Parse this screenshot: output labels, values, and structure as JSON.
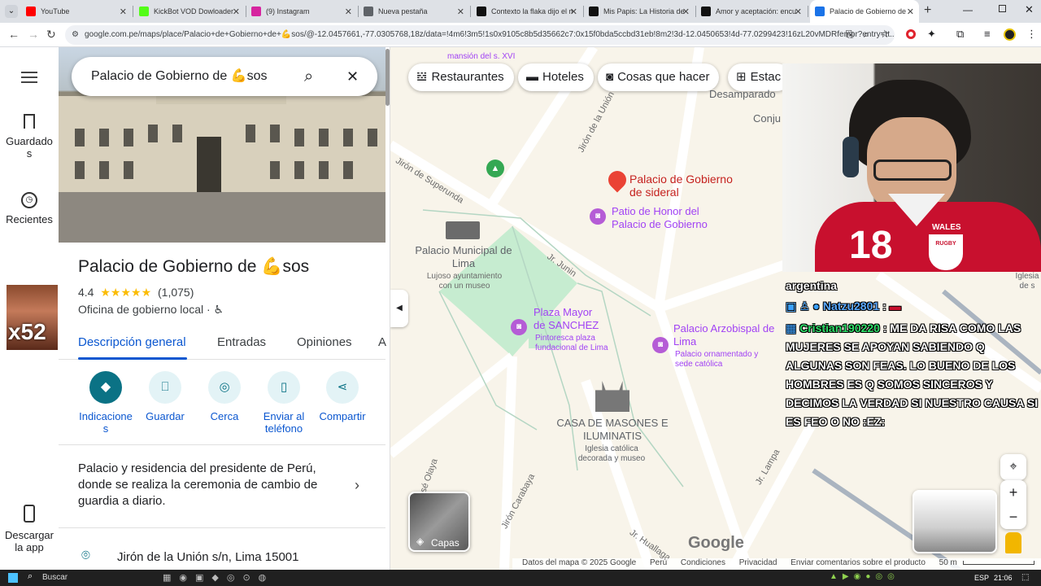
{
  "browser": {
    "tabs": [
      {
        "title": "YouTube",
        "color": "#ff0000"
      },
      {
        "title": "KickBot VOD Dowloader",
        "color": "#53fc18"
      },
      {
        "title": "(9) Instagram",
        "color": "#d6249f"
      },
      {
        "title": "Nueva pestaña",
        "color": "#5f6368"
      },
      {
        "title": "Contexto la flaka dijo el m",
        "color": "#111111"
      },
      {
        "title": "Mis Papis: La Historia de",
        "color": "#111111"
      },
      {
        "title": "Amor y aceptación: encu",
        "color": "#111111"
      },
      {
        "title": "Palacio de Gobierno de 💪sos",
        "color": "#1a73e8"
      }
    ],
    "url": "google.com.pe/maps/place/Palacio+de+Gobierno+de+💪sos/@-12.0457661,-77.0305768,18z/data=!4m6!3m5!1s0x9105c8b5d35662c7:0x15f0bda5ccbd31eb!8m2!3d-12.0450653!4d-77.0299423!16zL20vMDRfempr?entry=tt..."
  },
  "rail": {
    "saved": "Guardados",
    "recent": "Recientes",
    "thumb_badge": "x52",
    "download": "Descargar la app"
  },
  "place": {
    "search_value": "Palacio de Gobierno de 💪sos",
    "title": "Palacio de Gobierno de 💪sos",
    "rating": "4.4",
    "stars": "★★★★★",
    "reviews": "(1,075)",
    "category": "Oficina de gobierno local · ♿",
    "tabs": [
      "Descripción general",
      "Entradas",
      "Opiniones",
      "A"
    ],
    "actions": [
      "Indicaciones",
      "Guardar",
      "Cerca",
      "Enviar al teléfono",
      "Compartir"
    ],
    "description": "Palacio y residencia del presidente de Perú, donde se realiza la ceremonia de cambio de guardia a diario.",
    "address": "Jirón de la Unión s/n, Lima 15001"
  },
  "map": {
    "chips": [
      "Restaurantes",
      "Hoteles",
      "Cosas que hacer",
      "Estac"
    ],
    "pin_label": "Palacio de Gobierno de sideral",
    "labels": {
      "patio": "Patio de Honor del Palacio de Gobierno",
      "municipal": "Palacio Municipal de Lima",
      "municipal_sub": "Lujoso ayuntamiento con un museo",
      "plaza": "Plaza Mayor de SANCHEZ",
      "plaza_sub": "Pintoresca plaza fundacional de Lima",
      "arzobispal": "Palacio Arzobispal de Lima",
      "arzobispal_sub": "Palacio ornamentado y sede católica",
      "masones": "CASA DE MASONES E ILUMINATIS",
      "masones_sub": "Iglesia católica decorada y museo",
      "desamparado": "Desamparado",
      "conj": "Conju",
      "mansion": "mansión del s. XVI",
      "jr_union": "Jirón de la Unión",
      "superunda": "Jirón de Superunda",
      "junin": "Jr. Junin",
      "lampa": "Jr. Lampa",
      "olaya": "Jr. de José Olaya",
      "carabaya": "Jirón Carabaya",
      "huallaga": "Jr. Huallaga",
      "iglesia": "Iglesia de s"
    },
    "layers": "Capas",
    "google": "Google",
    "footer": [
      "Datos del mapa © 2025 Google",
      "Perú",
      "Condiciones",
      "Privacidad",
      "Enviar comentarios sobre el producto"
    ],
    "scale": "50 m"
  },
  "stream": {
    "jersey_number": "18",
    "jersey_text": "WALES",
    "crest_text": "RUGBY",
    "chat_top": "argentina",
    "user1": "Natzu2801",
    "user2": "Cristian190220",
    "message": "ME DA RISA COMO LAS MUJERES SE APOYAN SABIENDO Q ALGUNAS SON FEAS. LO BUENO DE LOS HOMBRES ES Q SOMOS SINCEROS Y DECIMOS LA VERDAD SI NUESTRO CAUSA SI ES FEO O NO :EZ:"
  },
  "taskbar": {
    "search": "Buscar",
    "lang": "ESP",
    "time": "21:06"
  }
}
